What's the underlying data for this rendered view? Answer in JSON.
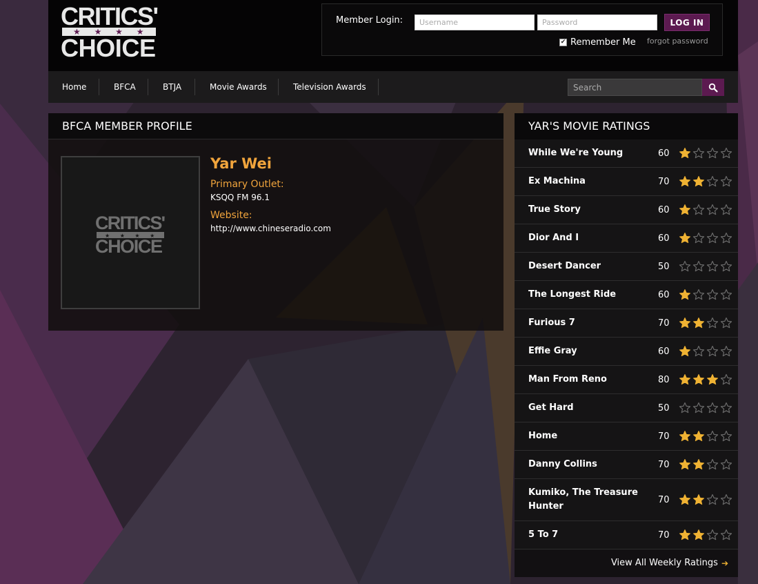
{
  "logo": {
    "line1": "CRITICS'",
    "line2": "CHOICE",
    "stars": "★ ★ ★ ★"
  },
  "login": {
    "label": "Member Login:",
    "username_placeholder": "Username",
    "password_placeholder": "Password",
    "button": "LOG IN",
    "remember": "Remember Me",
    "forgot": "forgot password"
  },
  "nav": {
    "items": [
      "Home",
      "BFCA",
      "BTJA",
      "Movie Awards",
      "Television Awards"
    ],
    "search_placeholder": "Search"
  },
  "profile": {
    "heading": "BFCA MEMBER PROFILE",
    "name": "Yar Wei",
    "outlet_label": "Primary Outlet:",
    "outlet": "KSQQ FM 96.1",
    "website_label": "Website:",
    "website": "http://www.chineseradio.com"
  },
  "ratings": {
    "heading": "YAR'S MOVIE RATINGS",
    "rows": [
      {
        "title": "While We're Young",
        "score": "60",
        "stars": 1
      },
      {
        "title": "Ex Machina",
        "score": "70",
        "stars": 2
      },
      {
        "title": "True Story",
        "score": "60",
        "stars": 1
      },
      {
        "title": "Dior And I",
        "score": "60",
        "stars": 1
      },
      {
        "title": "Desert Dancer",
        "score": "50",
        "stars": 0
      },
      {
        "title": "The Longest Ride",
        "score": "60",
        "stars": 1
      },
      {
        "title": "Furious 7",
        "score": "70",
        "stars": 2
      },
      {
        "title": "Effie Gray",
        "score": "60",
        "stars": 1
      },
      {
        "title": "Man From Reno",
        "score": "80",
        "stars": 3
      },
      {
        "title": "Get Hard",
        "score": "50",
        "stars": 0
      },
      {
        "title": "Home",
        "score": "70",
        "stars": 2
      },
      {
        "title": "Danny Collins",
        "score": "70",
        "stars": 2
      },
      {
        "title": "Kumiko, The Treasure Hunter",
        "score": "70",
        "stars": 2
      },
      {
        "title": "5 To 7",
        "score": "70",
        "stars": 2
      }
    ],
    "max_stars": 4,
    "view_all": "View All Weekly Ratings",
    "view_all_arrow": "➔"
  },
  "colors": {
    "accent": "#5c1a50",
    "gold": "#f0a43c",
    "star": "#efb233"
  }
}
